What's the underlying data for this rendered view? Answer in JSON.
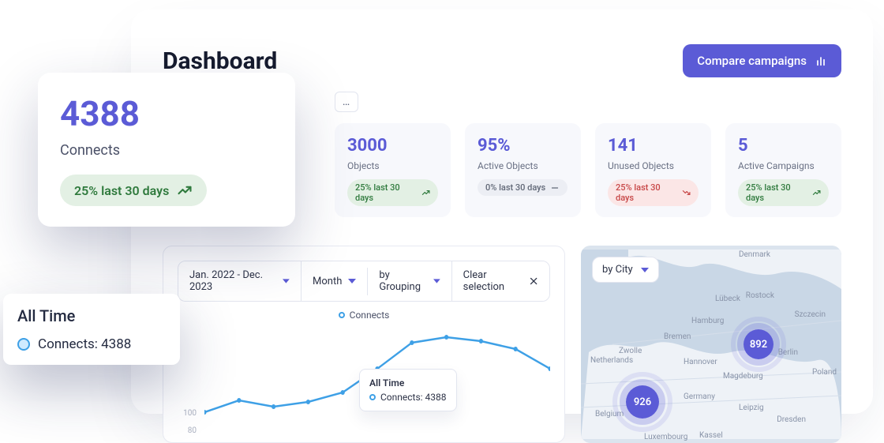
{
  "header": {
    "title": "Dashboard",
    "compare_label": "Compare campaigns",
    "more_label": "…"
  },
  "cards": [
    {
      "value": "3000",
      "label": "Objects",
      "pill_text": "25%  last 30 days",
      "trend": "up"
    },
    {
      "value": "95%",
      "label": "Active Objects",
      "pill_text": "0%  last 30 days",
      "trend": "flat"
    },
    {
      "value": "141",
      "label": "Unused Objects",
      "pill_text": "25% last 30 days",
      "trend": "down"
    },
    {
      "value": "5",
      "label": "Active Campaigns",
      "pill_text": "25%  last 30 days",
      "trend": "up"
    }
  ],
  "feature_card": {
    "value": "4388",
    "label": "Connects",
    "pill_text": "25%  last 30 days"
  },
  "alltime_card": {
    "title": "All Time",
    "series_label": "Connects: 4388"
  },
  "chart": {
    "filters": {
      "date_range": "Jan. 2022 - Dec. 2023",
      "interval": "Month",
      "grouping": "by Grouping",
      "clear": "Clear selection"
    },
    "legend_label": "Connects",
    "tooltip": {
      "title": "All Time",
      "row": "Connects: 4388"
    },
    "y_ticks": [
      "100",
      "80"
    ]
  },
  "chart_data": {
    "type": "line",
    "title": "",
    "xlabel": "",
    "ylabel": "",
    "ylim": [
      0,
      140
    ],
    "y_ticks": [
      80,
      100
    ],
    "series": [
      {
        "name": "Connects",
        "values": [
          55,
          70,
          62,
          68,
          80,
          102,
          128,
          135,
          130,
          122,
          100
        ]
      }
    ]
  },
  "map": {
    "filter_label": "by City",
    "bubbles": [
      {
        "value": "892"
      },
      {
        "value": "926"
      }
    ],
    "labels": [
      "Denmark",
      "Netherlands",
      "Germany",
      "Belgium",
      "Luxembourg",
      "Hamburg",
      "Bremen",
      "Berlin",
      "Poland",
      "Lübeck",
      "Zwolle",
      "Rostock",
      "Magdeburg",
      "Leipzig",
      "Dresden",
      "Hannover",
      "Szczecin",
      "Kassel"
    ]
  }
}
